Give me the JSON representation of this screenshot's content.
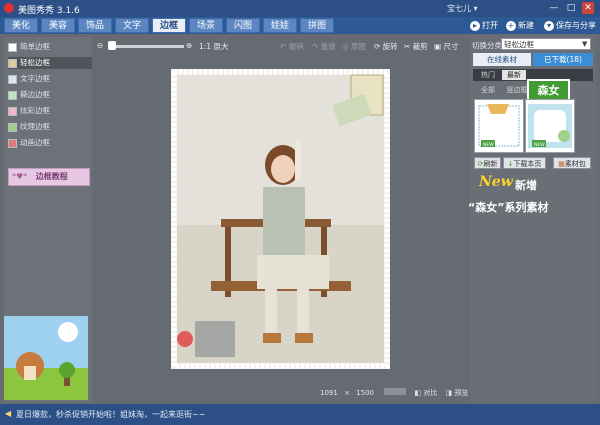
{
  "window": {
    "title": "美图秀秀 3.1.6",
    "user": "宝七儿 ▾",
    "controls": [
      "—",
      "□",
      "✕"
    ]
  },
  "tabs": [
    "美化",
    "美容",
    "饰品",
    "文字",
    "边框",
    "场景",
    "闪图",
    "娃娃",
    "拼图"
  ],
  "active_tab": "边框",
  "top_buttons": {
    "open": "打开",
    "new": "新建",
    "save_share": "保存与分享"
  },
  "left_panel": {
    "items": [
      "简单边框",
      "轻松边框",
      "文字边框",
      "撕边边框",
      "炫彩边框",
      "纹理边框",
      "动画边框"
    ],
    "selected": "轻松边框",
    "tutorial": "边框教程"
  },
  "toolbar": {
    "actual_size": "1:1 原大",
    "undo": "撤销",
    "redo": "重做",
    "reset": "原图",
    "rotate": "旋转",
    "crop": "裁剪",
    "size": "尺寸"
  },
  "right_panel": {
    "category_label": "切换分类",
    "category_value": "轻松边框",
    "online_tab": "在线素材",
    "downloaded_tab": "已下载(18)",
    "filter_hot": "热门",
    "filter_latest": "最新",
    "filter_all": "全部",
    "filter_vertical": "竖边框",
    "featured_badge": "森女",
    "new_tag": "NEW",
    "refresh": "刷新",
    "download_page": "下载本页",
    "material_pack": "素材包",
    "promo_new": "New",
    "promo_add": "新增",
    "promo_line": "“森女”系列素材"
  },
  "image_info": {
    "width": "1091",
    "times": "×",
    "height": "1500",
    "compare": "对比",
    "preview": "预览"
  },
  "status_text": "夏日爆款，秒杀促销开始啦！姐妹淘，一起来逛街~~",
  "colors": {
    "title_bar": "#2c4f86",
    "tab_bar": "#2d5a94",
    "active_tab": "#e9eef6",
    "workspace": "#666b73",
    "promo_yellow": "#ffd32a",
    "featured_green": "#3f9b32"
  }
}
